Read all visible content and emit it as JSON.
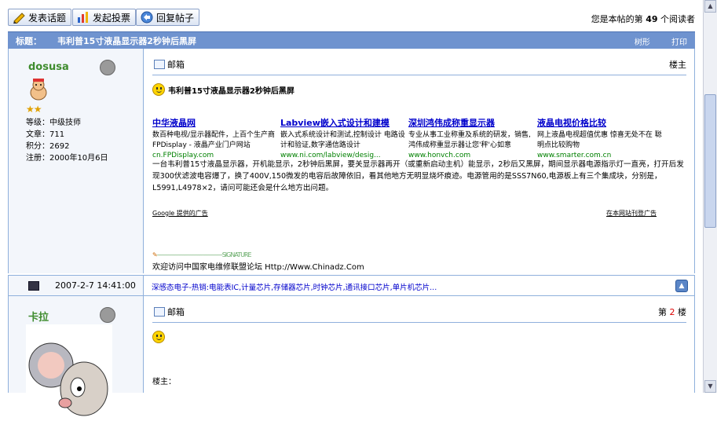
{
  "toolbar": {
    "new_topic": "发表话题",
    "new_poll": "发起投票",
    "reply": "回复帖子",
    "read_info_prefix": "您是本帖的第",
    "read_count": "49",
    "read_info_suffix": "个阅读者"
  },
  "thread": {
    "label": "标题：",
    "title": "韦利普15寸液晶显示器2秒钟后黑屏",
    "tree": "树形",
    "print": "打印"
  },
  "post1": {
    "username": "dosusa",
    "stars": "★★",
    "level": "等级：中级技师",
    "posts": "文章：711",
    "points": "积分：2692",
    "registered": "注册：2000年10月6日",
    "mail": "邮箱",
    "floor": "楼主",
    "title": "韦利普15寸液晶显示器2秒钟后黑屏",
    "ads": [
      {
        "title": "中华液晶网",
        "desc": "数百种电视/显示器配件，上百个生产商 FPDisplay - 液晶产业门户网站",
        "url": "cn.FPDisplay.com"
      },
      {
        "title": "Labview嵌入式设计和建模",
        "desc": "嵌入式系统设计和测试,控制设计 电路设计和验证,数字通信路设计",
        "url": "www.ni.com/labview/desig..."
      },
      {
        "title": "深圳鸿伟成称重显示器",
        "desc": "专业从事工业称重及系统的研发，销售,鸿伟成称重显示器让您'秤'心如意",
        "url": "www.honvch.com"
      },
      {
        "title": "液晶电视价格比较",
        "desc": "网上液晶电视超值优惠 惊喜无处不在 聪明点比较购物",
        "url": "www.smarter.com.cn"
      }
    ],
    "ad_footer_left": "Google 提供的广告",
    "ad_footer_right": "在本网站刊登广告",
    "body": "一台韦利普15寸液晶显示器，开机能显示，2秒钟后黑屏，要关显示器再开（或重新启动主机）能显示，2秒后又黑屏，期间显示器电源指示灯一直亮，打开后发现300伏滤波电容爆了，换了400V,150微发的电容后故障依旧，看其他地方无明显烧坏痕迹。电源管用的是SSS7N60,电源板上有三个集成块，分别是，L5991,L4978×2，请问可能还会是什么地方出问题。",
    "signature_label": "SIGNATURE",
    "signature": "欢迎访问中国家电维修联盟论坛 Http://Www.Chinadz.Com"
  },
  "inforow": {
    "datetime": "2007-2-7 14:41:00",
    "links": "深感态电子-热销:电能表IC,计量芯片,存储器芯片,时钟芯片,通讯接口芯片,单片机芯片...",
    "up": "▲"
  },
  "post2": {
    "username": "卡拉",
    "mail": "邮箱",
    "floor_prefix": "第",
    "floor_num": "2",
    "floor_suffix": "楼",
    "quote_label": "楼主："
  },
  "colors": {
    "header_blue": "#6f93cf",
    "border_blue": "#8fb0dc",
    "username_green": "#3f8c2e",
    "ad_link": "#0000cc",
    "ad_url": "#008000"
  }
}
